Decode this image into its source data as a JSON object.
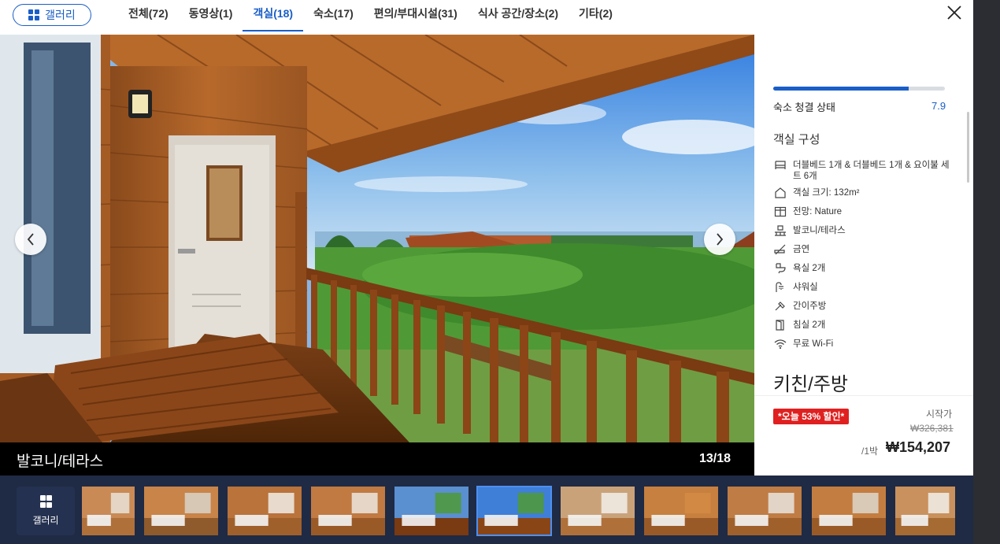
{
  "header": {
    "gallery_label": "갤러리",
    "tabs": [
      {
        "label": "전체(72)"
      },
      {
        "label": "동영상(1)"
      },
      {
        "label": "객실(18)"
      },
      {
        "label": "숙소(17)"
      },
      {
        "label": "편의/부대시설(31)"
      },
      {
        "label": "식사 공간/장소(2)"
      },
      {
        "label": "기타(2)"
      }
    ],
    "active_tab_index": 2
  },
  "photo": {
    "caption": "발코니/테라스",
    "counter": "13/18"
  },
  "panel": {
    "cleanliness_label": "숙소 청결 상태",
    "cleanliness_score": "7.9",
    "cleanliness_fraction": 0.79,
    "room_heading": "객실 구성",
    "features": [
      {
        "icon": "bed-icon",
        "text": "더블베드 1개 & 더블베드 1개 & 요이불 세트 6개"
      },
      {
        "icon": "room-size-icon",
        "text": "객실 크기: 132m²"
      },
      {
        "icon": "view-icon",
        "text": "전망: Nature"
      },
      {
        "icon": "balcony-icon",
        "text": "발코니/테라스"
      },
      {
        "icon": "no-smoking-icon",
        "text": "금연"
      },
      {
        "icon": "bathroom-icon",
        "text": "욕실 2개"
      },
      {
        "icon": "shower-icon",
        "text": "샤워실"
      },
      {
        "icon": "kitchenette-icon",
        "text": "간이주방"
      },
      {
        "icon": "bedroom-icon",
        "text": "침실 2개"
      },
      {
        "icon": "wifi-icon",
        "text": "무료 Wi-Fi"
      }
    ],
    "kitchen_heading": "키친/주방",
    "price": {
      "discount_prefix": "*오늘 ",
      "discount_percent": "53%",
      "discount_suffix": " 할인*",
      "from_label": "시작가",
      "original": "₩326,381",
      "per_night": "/1박",
      "final": "₩154,207"
    }
  },
  "thumbnails": {
    "gallery_label": "갤러리",
    "count": 11,
    "active_index": 5
  },
  "colors": {
    "accent": "#1a5ec7",
    "discount": "#e02020",
    "thumb_bar": "#1f2a44"
  }
}
